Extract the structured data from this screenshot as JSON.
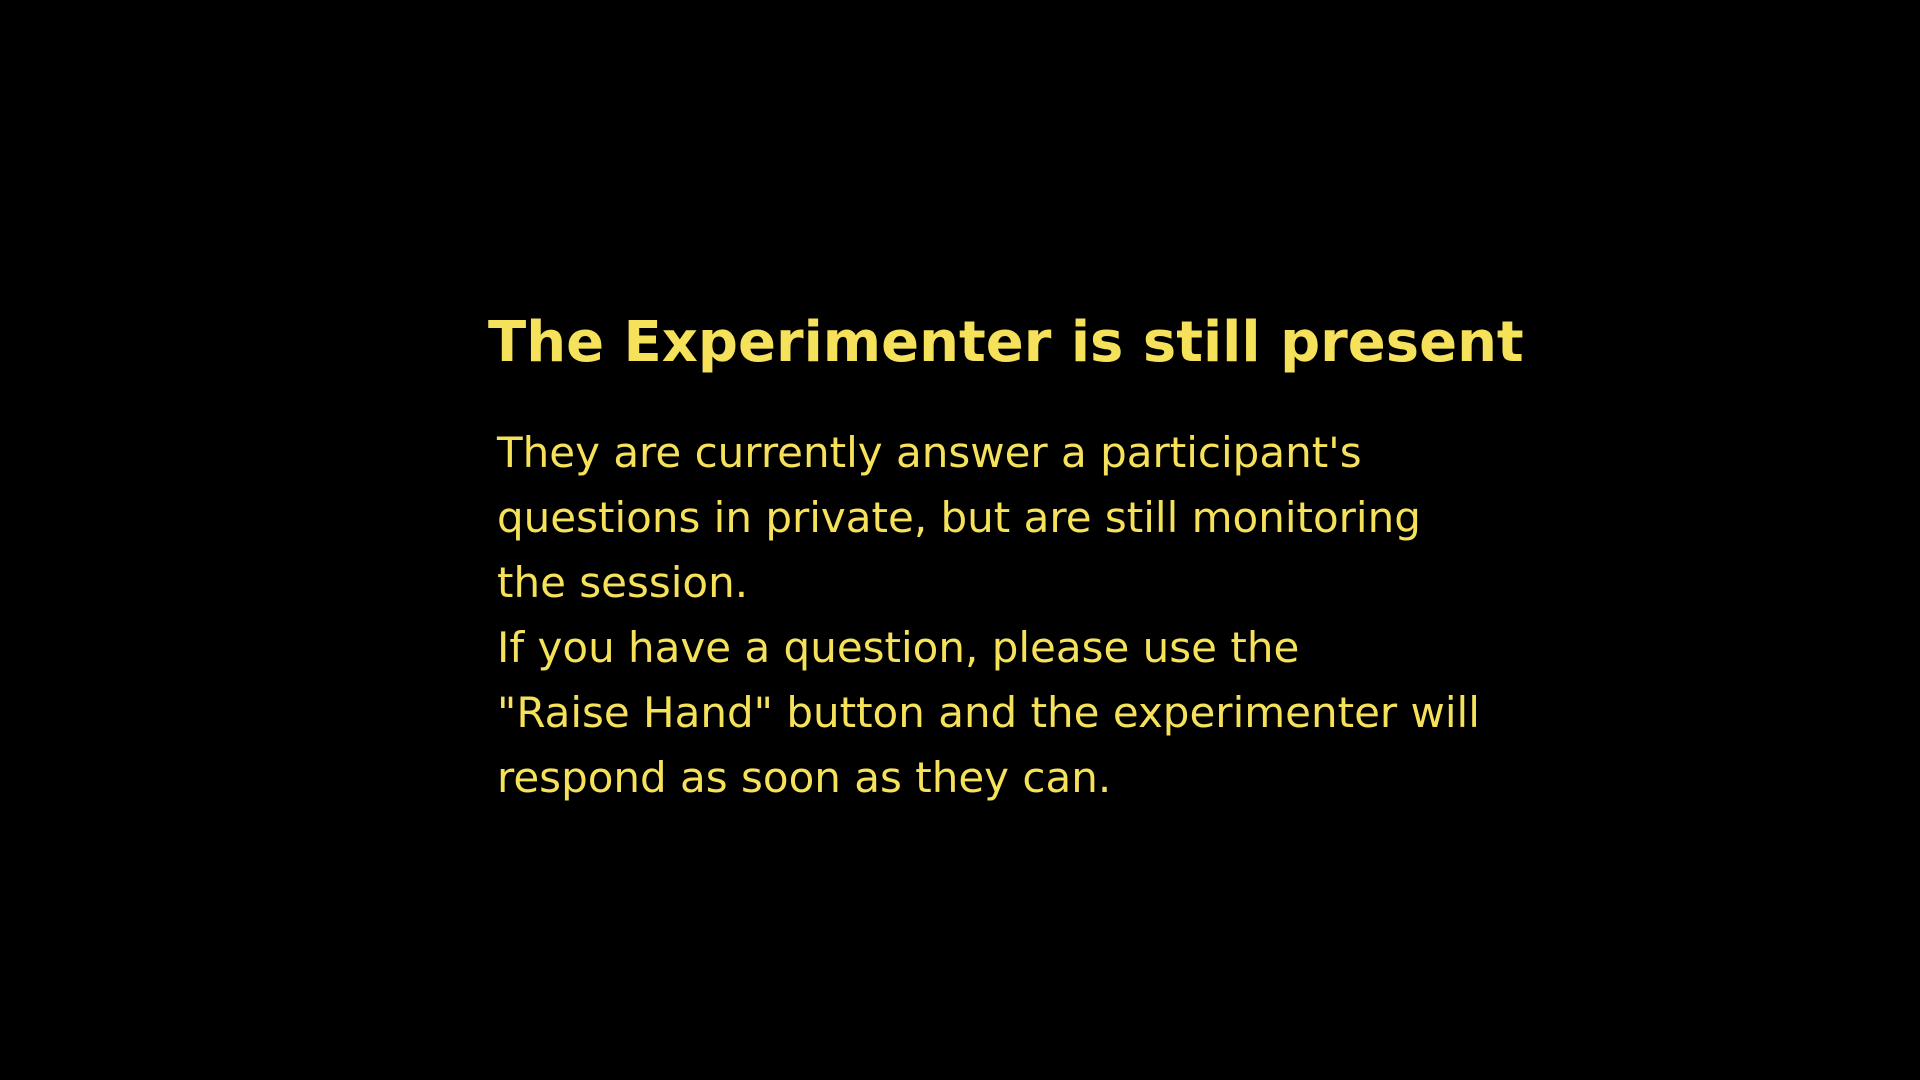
{
  "notice": {
    "title": "The Experimenter is still present",
    "lines": [
      "They are currently answer a participant's",
      "questions in private, but are still monitoring",
      "the session.",
      "If you have a question, please use the",
      "\"Raise Hand\" button and the experimenter will",
      "respond as soon as they can."
    ]
  },
  "colors": {
    "background": "#000000",
    "text": "#f5e15a"
  }
}
